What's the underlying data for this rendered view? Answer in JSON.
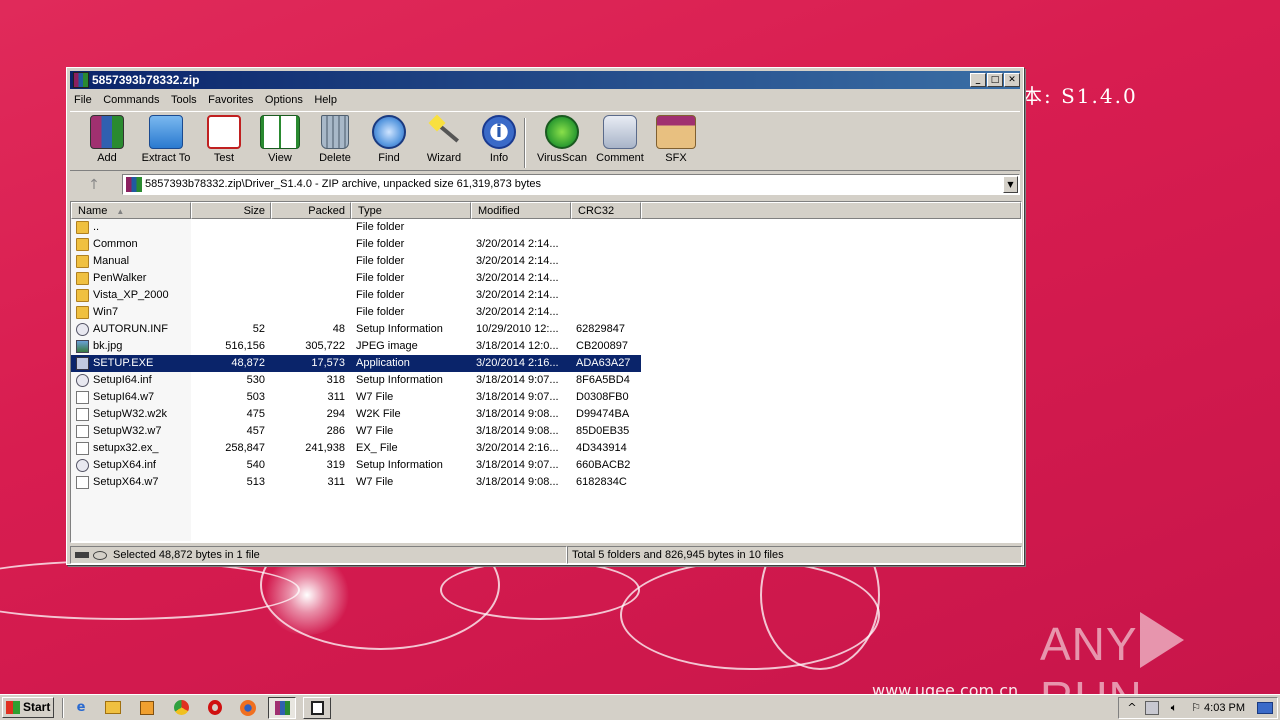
{
  "wallpaper": {
    "version_text": "本: S1.4.0",
    "url_text": "www.ugee.com.cn",
    "watermark": "ANY RUN"
  },
  "window": {
    "title": "5857393b78332.zip",
    "buttons": {
      "minimize": "_",
      "maximize": "□",
      "close": "✕"
    }
  },
  "menu": [
    "File",
    "Commands",
    "Tools",
    "Favorites",
    "Options",
    "Help"
  ],
  "toolbar": [
    {
      "label": "Add",
      "icon": "add-icon",
      "color": "#a03070"
    },
    {
      "label": "Extract To",
      "icon": "folder-extract-icon",
      "color": "#3a8ad8"
    },
    {
      "label": "Test",
      "icon": "clipboard-check-icon",
      "color": "#c02020"
    },
    {
      "label": "View",
      "icon": "book-icon",
      "color": "#2a8a30"
    },
    {
      "label": "Delete",
      "icon": "trash-icon",
      "color": "#8898a8"
    },
    {
      "label": "Find",
      "icon": "magnifier-icon",
      "color": "#2a6ac8"
    },
    {
      "label": "Wizard",
      "icon": "magic-wand-icon",
      "color": "#b8b820"
    },
    {
      "label": "Info",
      "icon": "info-icon",
      "color": "#2a5ab0"
    },
    {
      "label": "VirusScan",
      "icon": "virus-icon",
      "color": "#2a9a30"
    },
    {
      "label": "Comment",
      "icon": "comment-icon",
      "color": "#6a7a9a"
    },
    {
      "label": "SFX",
      "icon": "sfx-icon",
      "color": "#d08030"
    }
  ],
  "address": {
    "up_arrow": "↑",
    "path": "5857393b78332.zip\\Driver_S1.4.0 - ZIP archive, unpacked size 61,319,873 bytes",
    "dropdown": "▼"
  },
  "columns": {
    "name": "Name",
    "sort_indicator": "▲",
    "size": "Size",
    "packed": "Packed",
    "type": "Type",
    "modified": "Modified",
    "crc": "CRC32"
  },
  "files": [
    {
      "name": "..",
      "size": "",
      "packed": "",
      "type": "File folder",
      "modified": "",
      "crc": "",
      "icon": "folder"
    },
    {
      "name": "Common",
      "size": "",
      "packed": "",
      "type": "File folder",
      "modified": "3/20/2014 2:14...",
      "crc": "",
      "icon": "folder"
    },
    {
      "name": "Manual",
      "size": "",
      "packed": "",
      "type": "File folder",
      "modified": "3/20/2014 2:14...",
      "crc": "",
      "icon": "folder"
    },
    {
      "name": "PenWalker",
      "size": "",
      "packed": "",
      "type": "File folder",
      "modified": "3/20/2014 2:14...",
      "crc": "",
      "icon": "folder"
    },
    {
      "name": "Vista_XP_2000",
      "size": "",
      "packed": "",
      "type": "File folder",
      "modified": "3/20/2014 2:14...",
      "crc": "",
      "icon": "folder"
    },
    {
      "name": "Win7",
      "size": "",
      "packed": "",
      "type": "File folder",
      "modified": "3/20/2014 2:14...",
      "crc": "",
      "icon": "folder"
    },
    {
      "name": "AUTORUN.INF",
      "size": "52",
      "packed": "48",
      "type": "Setup Information",
      "modified": "10/29/2010 12:...",
      "crc": "62829847",
      "icon": "cfg"
    },
    {
      "name": "bk.jpg",
      "size": "516,156",
      "packed": "305,722",
      "type": "JPEG image",
      "modified": "3/18/2014 12:0...",
      "crc": "CB200897",
      "icon": "img"
    },
    {
      "name": "SETUP.EXE",
      "size": "48,872",
      "packed": "17,573",
      "type": "Application",
      "modified": "3/20/2014 2:16...",
      "crc": "ADA63A27",
      "icon": "exe",
      "selected": true
    },
    {
      "name": "SetupI64.inf",
      "size": "530",
      "packed": "318",
      "type": "Setup Information",
      "modified": "3/18/2014 9:07...",
      "crc": "8F6A5BD4",
      "icon": "cfg"
    },
    {
      "name": "SetupI64.w7",
      "size": "503",
      "packed": "311",
      "type": "W7 File",
      "modified": "3/18/2014 9:07...",
      "crc": "D0308FB0",
      "icon": "doc"
    },
    {
      "name": "SetupW32.w2k",
      "size": "475",
      "packed": "294",
      "type": "W2K File",
      "modified": "3/18/2014 9:08...",
      "crc": "D99474BA",
      "icon": "doc"
    },
    {
      "name": "SetupW32.w7",
      "size": "457",
      "packed": "286",
      "type": "W7 File",
      "modified": "3/18/2014 9:08...",
      "crc": "85D0EB35",
      "icon": "doc"
    },
    {
      "name": "setupx32.ex_",
      "size": "258,847",
      "packed": "241,938",
      "type": "EX_ File",
      "modified": "3/20/2014 2:16...",
      "crc": "4D343914",
      "icon": "doc"
    },
    {
      "name": "SetupX64.inf",
      "size": "540",
      "packed": "319",
      "type": "Setup Information",
      "modified": "3/18/2014 9:07...",
      "crc": "660BACB2",
      "icon": "cfg"
    },
    {
      "name": "SetupX64.w7",
      "size": "513",
      "packed": "311",
      "type": "W7 File",
      "modified": "3/18/2014 9:08...",
      "crc": "6182834C",
      "icon": "doc"
    }
  ],
  "status": {
    "left": "Selected 48,872 bytes in 1 file",
    "right": "Total 5 folders and 826,945 bytes in 10 files"
  },
  "taskbar": {
    "start": "Start",
    "clock": "4:03 PM"
  }
}
